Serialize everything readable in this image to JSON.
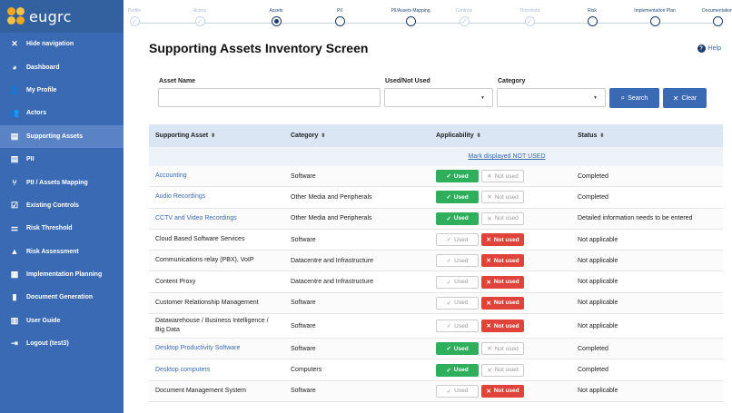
{
  "brand": {
    "logo_text": "eugrc"
  },
  "sidebar": {
    "items": [
      {
        "icon": "close-icon",
        "glyph": "✕",
        "label": "Hide navigation"
      },
      {
        "icon": "dashboard-icon",
        "glyph": "◕",
        "label": "Dashboard"
      },
      {
        "icon": "user-icon",
        "glyph": "👤",
        "label": "My Profile"
      },
      {
        "icon": "actors-icon",
        "glyph": "👥",
        "label": "Actors"
      },
      {
        "icon": "assets-icon",
        "glyph": "▤",
        "label": "Supporting Assets",
        "active": true
      },
      {
        "icon": "pii-icon",
        "glyph": "▤",
        "label": "PII"
      },
      {
        "icon": "mapping-icon",
        "glyph": "⑂",
        "label": "PII / Assets Mapping"
      },
      {
        "icon": "check-icon",
        "glyph": "☑",
        "label": "Existing Controls"
      },
      {
        "icon": "threshold-icon",
        "glyph": "⚌",
        "label": "Risk Threshold"
      },
      {
        "icon": "warning-icon",
        "glyph": "▲",
        "label": "Risk Assessment"
      },
      {
        "icon": "calendar-icon",
        "glyph": "▦",
        "label": "Implementation Planning"
      },
      {
        "icon": "document-icon",
        "glyph": "▮",
        "label": "Document Generation"
      },
      {
        "icon": "book-icon",
        "glyph": "▥",
        "label": "User Guide"
      },
      {
        "icon": "logout-icon",
        "glyph": "⇥",
        "label": "Logout (test3)"
      }
    ]
  },
  "stepper": {
    "steps": [
      {
        "label": "Profile",
        "state": "done"
      },
      {
        "label": "Actors",
        "state": "done"
      },
      {
        "label": "Assets",
        "state": "current"
      },
      {
        "label": "PII",
        "state": "todo"
      },
      {
        "label": "PII/Assets Mapping",
        "state": "todo"
      },
      {
        "label": "Controls",
        "state": "done"
      },
      {
        "label": "Threshold",
        "state": "done"
      },
      {
        "label": "Risk",
        "state": "todo"
      },
      {
        "label": "Implementation Plan",
        "state": "todo"
      },
      {
        "label": "Documentation",
        "state": "todo"
      }
    ]
  },
  "page": {
    "title": "Supporting Assets Inventory Screen",
    "help_label": "Help",
    "help_glyph": "?"
  },
  "filters": {
    "asset_name_label": "Asset Name",
    "asset_name_value": "",
    "used_label": "Used/Not Used",
    "used_value": "",
    "category_label": "Category",
    "category_value": "",
    "search_label": "Search",
    "clear_label": "Clear"
  },
  "table": {
    "headers": [
      "Supporting Asset",
      "Category",
      "Applicability",
      "Status"
    ],
    "mark_link": "Mark displayed NOT USED",
    "used_label": "Used",
    "not_used_label": "Not used",
    "rows": [
      {
        "asset": "Accounting",
        "category": "Software",
        "used": true,
        "status": "Completed"
      },
      {
        "asset": "Audio Recordings",
        "category": "Other Media and Peripherals",
        "used": true,
        "status": "Completed"
      },
      {
        "asset": "CCTV and Video Recordings",
        "category": "Other Media and Peripherals",
        "used": true,
        "status": "Detailed information needs to be entered"
      },
      {
        "asset": "Cloud Based Software Services",
        "category": "Software",
        "used": false,
        "status": "Not applicable"
      },
      {
        "asset": "Communications relay (PBX), VoIP",
        "category": "Datacentre and Infrastructure",
        "used": false,
        "status": "Not applicable"
      },
      {
        "asset": "Content Proxy",
        "category": "Datacentre and Infrastructure",
        "used": false,
        "status": "Not applicable"
      },
      {
        "asset": "Customer Relationship Management",
        "category": "Software",
        "used": false,
        "status": "Not applicable"
      },
      {
        "asset": "Datawarehouse / Business Intelligence / Big Data",
        "category": "Software",
        "used": false,
        "status": "Not applicable"
      },
      {
        "asset": "Desktop Productivity Software",
        "category": "Software",
        "used": true,
        "status": "Completed"
      },
      {
        "asset": "Desktop computers",
        "category": "Computers",
        "used": true,
        "status": "Completed"
      },
      {
        "asset": "Document Management System",
        "category": "Software",
        "used": false,
        "status": "Not applicable"
      }
    ]
  },
  "colors": {
    "sidebar": "#3b6ab5",
    "used": "#2fae5c",
    "not_used": "#e0433a",
    "link": "#3b6ab5"
  }
}
